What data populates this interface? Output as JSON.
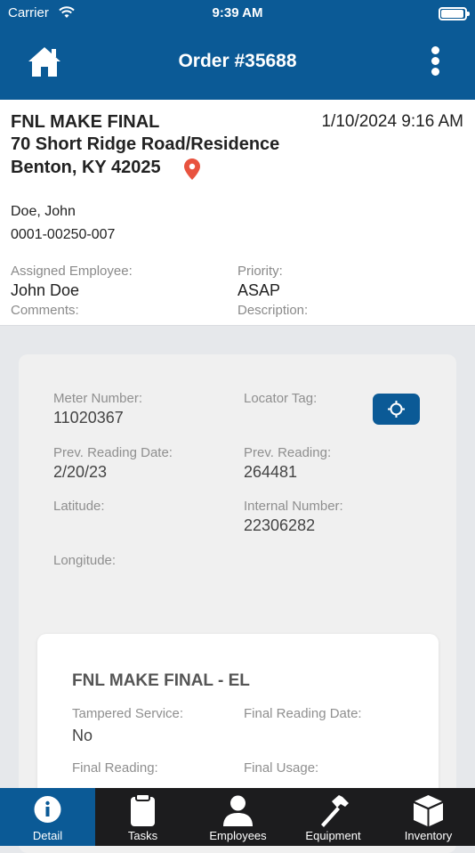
{
  "status_bar": {
    "carrier": "Carrier",
    "time": "9:39 AM"
  },
  "header": {
    "title": "Order #35688"
  },
  "order": {
    "type": "FNL MAKE FINAL",
    "date": "1/10/2024 9:16 AM",
    "address_line1": "70 Short Ridge Road/Residence",
    "address_line2": "Benton, KY 42025",
    "customer_name": "Doe, John",
    "account_number": "0001-00250-007",
    "assigned_employee_label": "Assigned Employee:",
    "assigned_employee": "John Doe",
    "priority_label": "Priority:",
    "priority": "ASAP",
    "comments_label": "Comments:",
    "description_label": "Description:"
  },
  "meter": {
    "meter_number_label": "Meter Number:",
    "meter_number": "11020367",
    "locator_tag_label": "Locator Tag:",
    "prev_reading_date_label": "Prev. Reading Date:",
    "prev_reading_date": "2/20/23",
    "prev_reading_label": "Prev. Reading:",
    "prev_reading": "264481",
    "latitude_label": "Latitude:",
    "internal_number_label": "Internal Number:",
    "internal_number": "22306282",
    "longitude_label": "Longitude:"
  },
  "final_card": {
    "title": "FNL MAKE FINAL - EL",
    "tampered_label": "Tampered Service:",
    "tampered_value": "No",
    "final_reading_date_label": "Final Reading Date:",
    "final_reading_label": "Final Reading:",
    "final_usage_label": "Final Usage:"
  },
  "tabs": [
    {
      "label": "Detail",
      "icon": "info-icon",
      "active": true
    },
    {
      "label": "Tasks",
      "icon": "clipboard-icon",
      "active": false
    },
    {
      "label": "Employees",
      "icon": "person-icon",
      "active": false
    },
    {
      "label": "Equipment",
      "icon": "hammer-icon",
      "active": false
    },
    {
      "label": "Inventory",
      "icon": "box-icon",
      "active": false
    }
  ],
  "colors": {
    "brand": "#0b5a96",
    "pin": "#e8533f",
    "tabbar": "#1c1c1e"
  }
}
